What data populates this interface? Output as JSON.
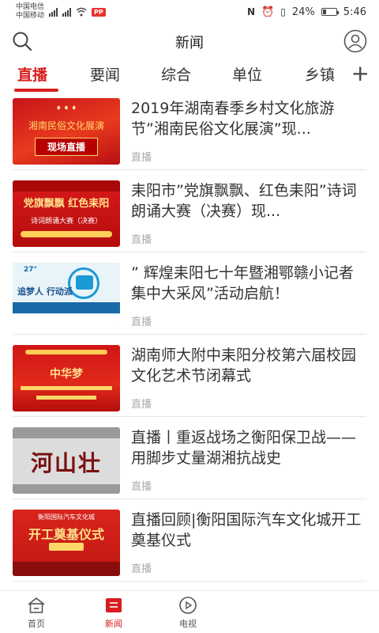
{
  "status_bar": {
    "carrier1": "中国电信",
    "carrier2": "中国移动",
    "net_badge": "PP",
    "battery": "24%",
    "battery_level": 0.24,
    "time": "5:46"
  },
  "header": {
    "title": "新闻"
  },
  "tabs": [
    {
      "label": "直播",
      "active": true
    },
    {
      "label": "要闻"
    },
    {
      "label": "综合"
    },
    {
      "label": "单位"
    },
    {
      "label": "乡镇"
    }
  ],
  "tab_add_label": "+",
  "items": [
    {
      "title": "2019年湖南春季乡村文化旅游节”湘南民俗文化展演”现...",
      "tag": "直播",
      "thumb_text": "现场直播",
      "thumb_sub": "湘南民俗文化展演"
    },
    {
      "title": "耒阳市”党旗飘飘、红色耒阳”诗词朗诵大赛（决赛）现...",
      "tag": "直播",
      "thumb_text": "党旗飘飘 红色耒阳",
      "thumb_sub": "诗词朗诵大赛（决赛）"
    },
    {
      "title": "” 辉煌耒阳七十年暨湘鄂赣小记者集中大采风”活动启航！",
      "tag": "直播",
      "thumb_text": "追梦人 行动派",
      "thumb_sub": "27°"
    },
    {
      "title": "湖南师大附中耒阳分校第六届校园文化艺术节闭幕式",
      "tag": "直播",
      "thumb_text": "中华梦",
      "thumb_sub": ""
    },
    {
      "title": "直播丨重返战场之衡阳保卫战——用脚步丈量湖湘抗战史",
      "tag": "直播",
      "thumb_text": "河山壮",
      "thumb_sub": ""
    },
    {
      "title": "直播回顾|衡阳国际汽车文化城开工奠基仪式",
      "tag": "直播",
      "thumb_text": "开工奠基仪式",
      "thumb_sub": "衡阳国际汽车文化城"
    }
  ],
  "bottom_nav": [
    {
      "label": "首页",
      "icon": "home-icon"
    },
    {
      "label": "新闻",
      "icon": "news-icon",
      "active": true
    },
    {
      "label": "电视",
      "icon": "tv-icon"
    }
  ],
  "colors": {
    "accent": "#d81e1e",
    "tag_gray": "#aaaaaa"
  }
}
